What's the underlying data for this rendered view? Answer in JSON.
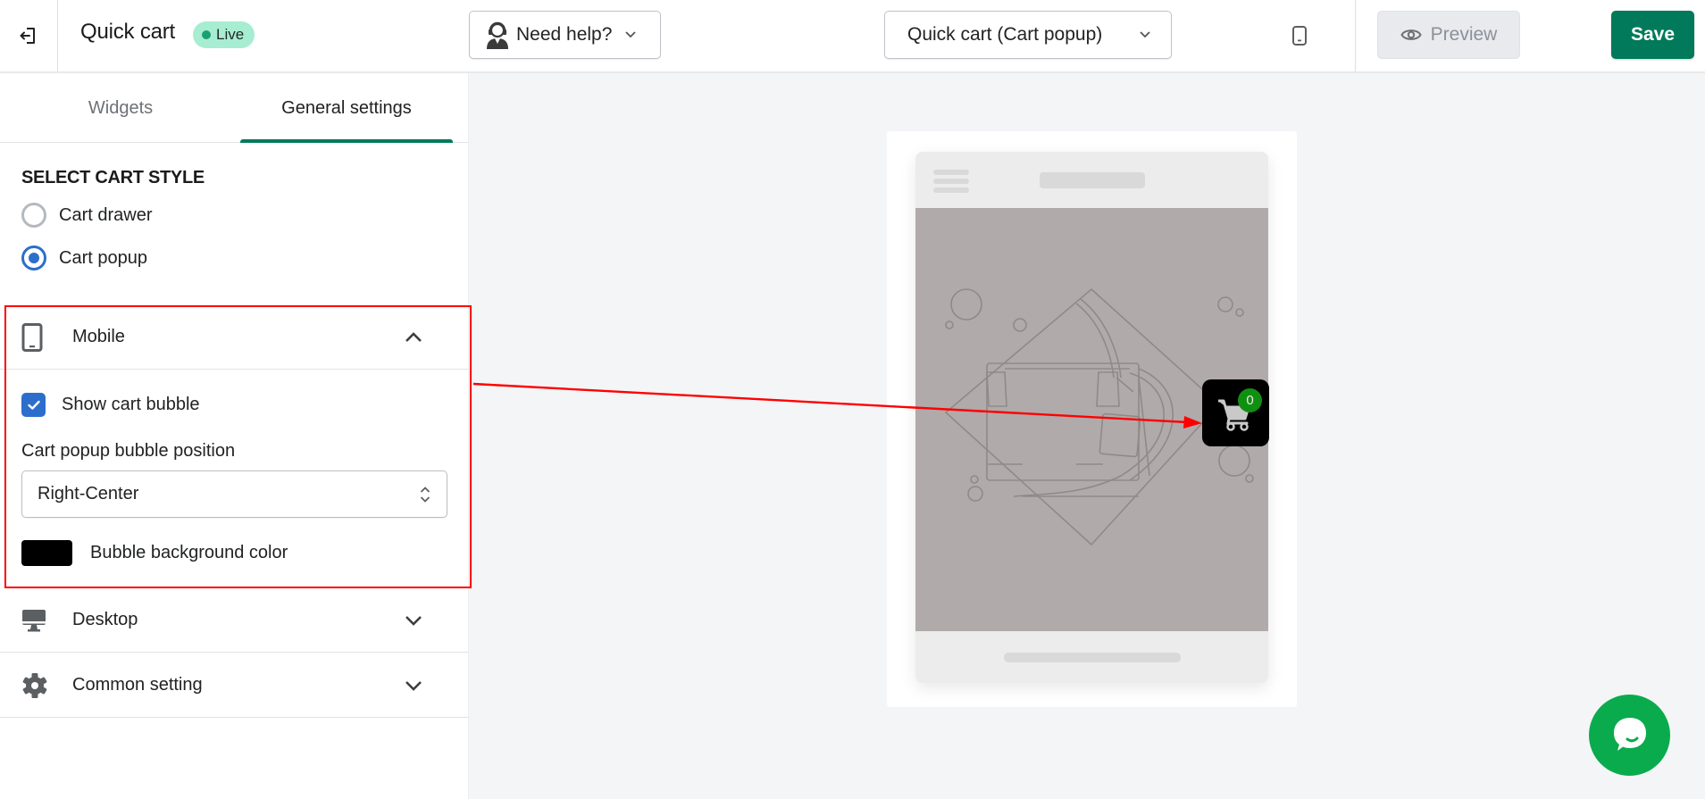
{
  "header": {
    "app_title": "Quick cart",
    "status_badge": "Live",
    "help_button": "Need help?",
    "page_selector": "Quick cart (Cart popup)",
    "preview_button": "Preview",
    "save_button": "Save"
  },
  "tabs": [
    {
      "label": "Widgets",
      "active": false
    },
    {
      "label": "General settings",
      "active": true
    }
  ],
  "cart_style": {
    "title": "SELECT CART STYLE",
    "options": [
      {
        "label": "Cart drawer",
        "selected": false
      },
      {
        "label": "Cart popup",
        "selected": true
      }
    ]
  },
  "sections": {
    "mobile": {
      "label": "Mobile",
      "expanded": true,
      "show_bubble_label": "Show cart bubble",
      "show_bubble_checked": true,
      "position_label": "Cart popup bubble position",
      "position_value": "Right-Center",
      "bg_color_label": "Bubble background color",
      "bg_color": "#000000"
    },
    "desktop": {
      "label": "Desktop",
      "expanded": false
    },
    "common": {
      "label": "Common setting",
      "expanded": false
    }
  },
  "preview": {
    "cart_count": "0",
    "bubble_color": "#000000",
    "count_badge_color": "#109010"
  },
  "colors": {
    "accent": "#007a5a",
    "checkbox": "#2c6ecb",
    "annotation": "#ff0000",
    "chat": "#0aab4c"
  }
}
